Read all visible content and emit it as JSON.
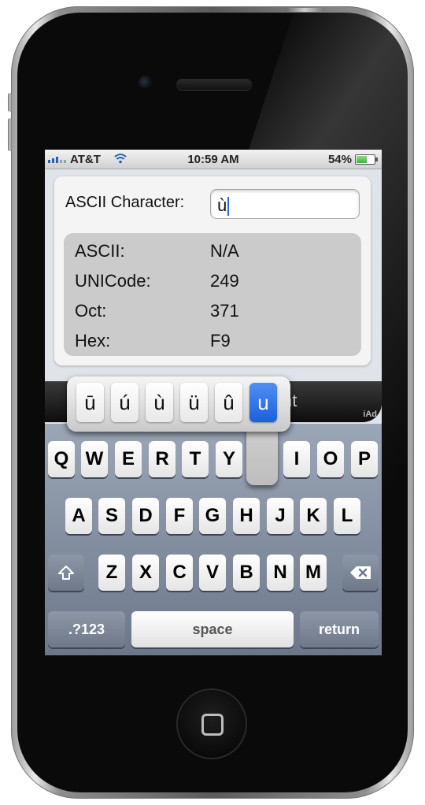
{
  "status": {
    "carrier": "AT&T",
    "time": "10:59 AM",
    "battery": "54%"
  },
  "form": {
    "label": "ASCII Character:",
    "value": "ù"
  },
  "info_rows": [
    {
      "key": "ASCII:",
      "value": "N/A"
    },
    {
      "key": "UNICode:",
      "value": "249"
    },
    {
      "key": "Oct:",
      "value": "371"
    },
    {
      "key": "Hex:",
      "value": "F9"
    }
  ],
  "ad": {
    "text": "nt",
    "tag": "iAd"
  },
  "accent_popup": {
    "options": [
      "ū",
      "ú",
      "ù",
      "ü",
      "û",
      "u"
    ],
    "selected": "u"
  },
  "keyboard": {
    "row1": [
      "Q",
      "W",
      "E",
      "R",
      "T",
      "Y",
      "I",
      "O",
      "P"
    ],
    "row2": [
      "A",
      "S",
      "D",
      "F",
      "G",
      "H",
      "J",
      "K",
      "L"
    ],
    "row3": [
      "Z",
      "X",
      "C",
      "V",
      "B",
      "N",
      "M"
    ],
    "numbers_key": ".?123",
    "space_key": "space",
    "return_key": "return"
  },
  "colors": {
    "selection": "#1d5fdc",
    "caret": "#2c68d6"
  }
}
